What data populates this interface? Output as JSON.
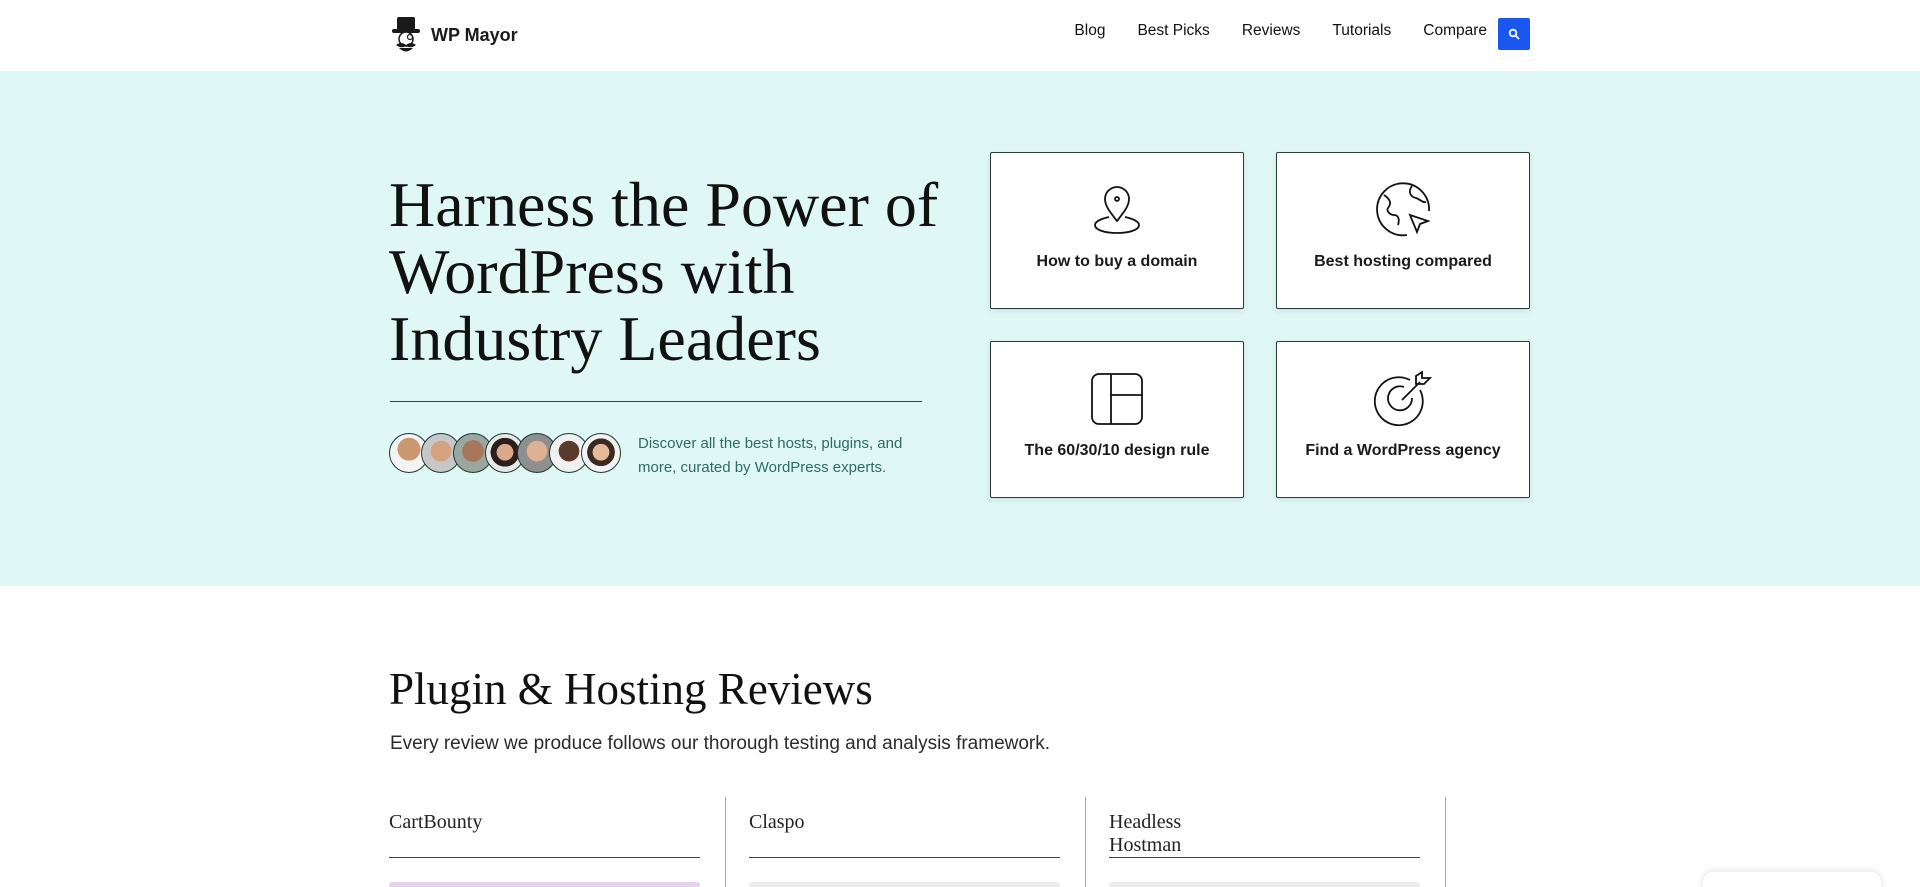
{
  "header": {
    "brand": "WP Mayor",
    "nav": [
      "Blog",
      "Best Picks",
      "Reviews",
      "Tutorials",
      "Compare"
    ],
    "search_icon": "search-icon"
  },
  "hero": {
    "title": "Harness the Power of WordPress with Industry Leaders",
    "description": "Discover all the best hosts, plugins, and more, curated by WordPress experts.",
    "avatar_count": 7,
    "cards": [
      {
        "label": "How to buy a domain",
        "icon": "map-pin-icon"
      },
      {
        "label": "Best hosting compared",
        "icon": "globe-cursor-icon"
      },
      {
        "label": "The 60/30/10 design rule",
        "icon": "layout-grid-icon"
      },
      {
        "label": "Find a WordPress agency",
        "icon": "target-arrow-icon"
      }
    ],
    "bg_color": "#dff8f6"
  },
  "reviews": {
    "title": "Plugin & Hosting Reviews",
    "subtitle": "Every review we produce follows our thorough testing and analysis framework.",
    "items": [
      {
        "name": "CartBounty"
      },
      {
        "name": "Claspo"
      },
      {
        "name": "Headless Hostman"
      }
    ]
  },
  "colors": {
    "accent": "#1a56f0",
    "teal_text": "#2d6b63",
    "divider": "#55c9c0"
  }
}
